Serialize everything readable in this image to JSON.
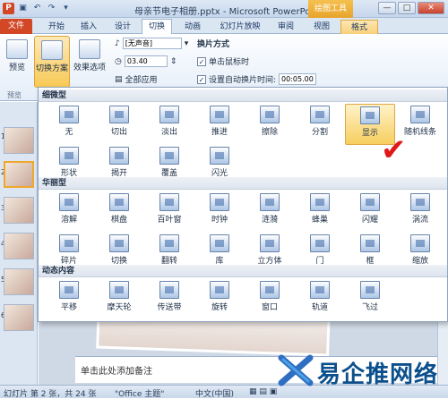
{
  "window": {
    "title": "母亲节电子相册.pptx - Microsoft PowerPoint",
    "context_tab": "绘图工具"
  },
  "tabs": [
    "文件",
    "开始",
    "插入",
    "设计",
    "切换",
    "动画",
    "幻灯片放映",
    "审阅",
    "视图",
    "格式"
  ],
  "active_tab": "切换",
  "ribbon": {
    "preview_label": "预览",
    "switch_scheme_label": "切换方案",
    "effect_options_label": "效果选项",
    "preview_group_label": "预览",
    "sound_value": "[无声音]",
    "duration_value": "03.40",
    "apply_all_label": "全部应用",
    "switch_mode_label": "换片方式",
    "on_click_label": "单击鼠标时",
    "auto_time_label": "设置自动换片时间:",
    "auto_time_value": "00:05.00"
  },
  "gallery": {
    "categories": [
      {
        "name": "细微型",
        "items": [
          "无",
          "切出",
          "淡出",
          "推进",
          "擦除",
          "分割",
          "显示",
          "随机线条",
          "形状",
          "揭开",
          "覆盖",
          "闪光"
        ]
      },
      {
        "name": "华丽型",
        "items": [
          "溶解",
          "棋盘",
          "百叶窗",
          "时钟",
          "涟漪",
          "蜂巢",
          "闪耀",
          "涡流",
          "碎片",
          "切换",
          "翻转",
          "库",
          "立方体",
          "门",
          "框",
          "缩放"
        ]
      },
      {
        "name": "动态内容",
        "items": [
          "平移",
          "摩天轮",
          "传送带",
          "旋转",
          "窗口",
          "轨道",
          "飞过"
        ]
      }
    ],
    "selected_item": "显示",
    "checkmark": "✔"
  },
  "slides": {
    "numbers": [
      "1",
      "2",
      "3",
      "4",
      "5",
      "6"
    ],
    "selected": "2"
  },
  "notes_placeholder": "单击此处添加备注",
  "status": {
    "slide_info": "幻灯片 第 2 张，共 24 张",
    "theme": "\"Office 主题\"",
    "language": "中文(中国)"
  },
  "watermark": "易企推网络",
  "colors": {
    "file_tab": "#d24726",
    "selected": "#f7ce5f",
    "check": "#e01818"
  }
}
